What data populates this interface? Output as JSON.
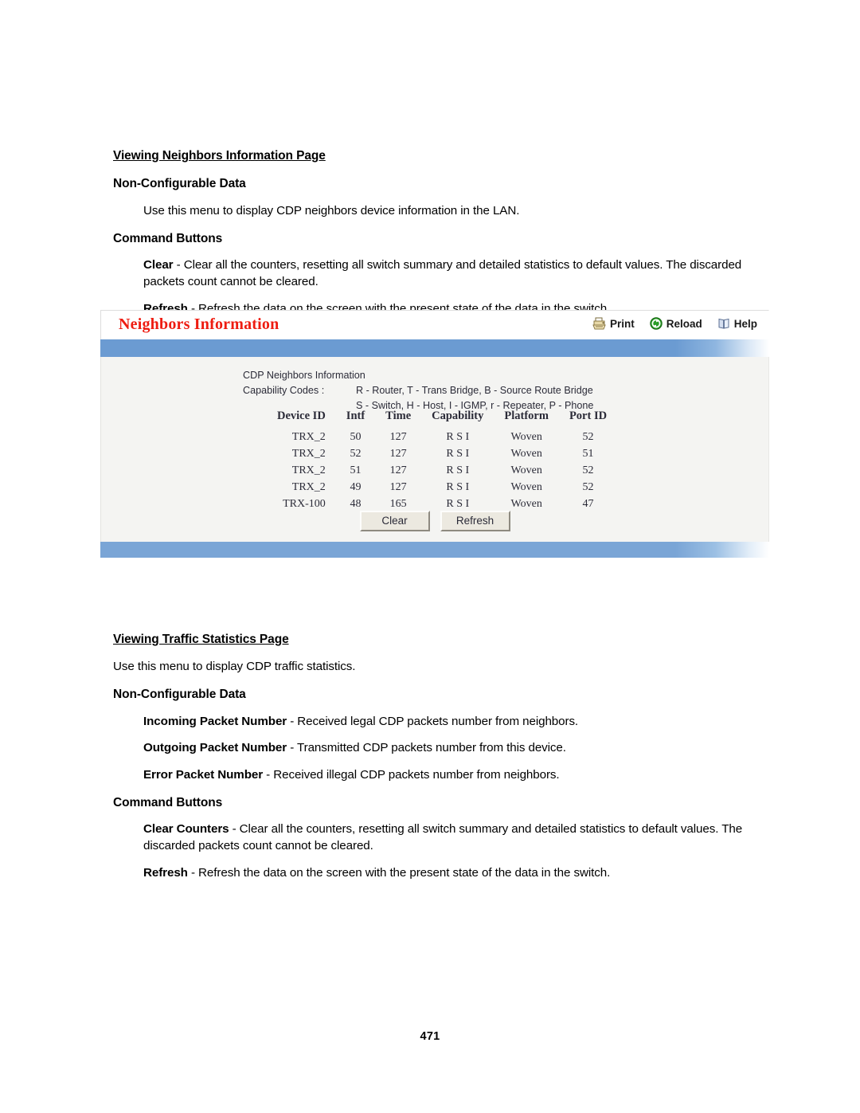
{
  "document": {
    "page_number": "471"
  },
  "section_one": {
    "heading": "Viewing Neighbors Information Page",
    "subheading_data": "Non-Configurable Data",
    "data_text": "Use this menu to display CDP neighbors device information in the LAN.",
    "subheading_buttons": "Command Buttons",
    "clear_label": "Clear",
    "clear_desc": " - Clear all the counters, resetting all switch summary and detailed statistics to default values. The discarded packets count cannot be cleared.",
    "refresh_label": "Refresh",
    "refresh_desc": " - Refresh the data on the screen with the present state of the data in the switch."
  },
  "screenshot": {
    "title": "Neighbors Information",
    "toolbar": [
      {
        "label": "Print",
        "icon": "printer-icon"
      },
      {
        "label": "Reload",
        "icon": "reload-icon"
      },
      {
        "label": "Help",
        "icon": "help-book-icon"
      }
    ],
    "info_title": "CDP Neighbors Information",
    "capability_label": "Capability Codes :",
    "capability_line1": "R - Router, T - Trans Bridge, B - Source Route Bridge",
    "capability_line2": "S - Switch, H - Host, I - IGMP, r - Repeater, P - Phone",
    "table": {
      "headers": [
        "Device ID",
        "Intf",
        "Time",
        "Capability",
        "Platform",
        "Port ID"
      ],
      "rows": [
        [
          "TRX_2",
          "50",
          "127",
          "R S I",
          "Woven",
          "52"
        ],
        [
          "TRX_2",
          "52",
          "127",
          "R S I",
          "Woven",
          "51"
        ],
        [
          "TRX_2",
          "51",
          "127",
          "R S I",
          "Woven",
          "52"
        ],
        [
          "TRX_2",
          "49",
          "127",
          "R S I",
          "Woven",
          "52"
        ],
        [
          "TRX-100",
          "48",
          "165",
          "R S I",
          "Woven",
          "47"
        ]
      ]
    },
    "buttons": [
      {
        "label": "Clear"
      },
      {
        "label": "Refresh"
      }
    ],
    "colors": {
      "title_red": "#ee1c11",
      "accent_blue": "#6b9bd2",
      "body_gray": "#f4f4f2"
    }
  },
  "section_two": {
    "heading": "Viewing Traffic Statistics Page",
    "intro_text": "Use this menu to display CDP traffic statistics.",
    "subheading_data": "Non-Configurable Data",
    "incoming_label": "Incoming Packet Number",
    "incoming_desc": " - Received legal CDP packets number from neighbors.",
    "outgoing_label": "Outgoing Packet Number",
    "outgoing_desc": " - Transmitted CDP packets number from this device.",
    "error_label": "Error Packet Number",
    "error_desc": " - Received illegal CDP packets number from neighbors.",
    "subheading_buttons": "Command Buttons",
    "clear_counters_label": "Clear Counters",
    "clear_counters_desc": " - Clear all the counters, resetting all switch summary and detailed statistics to default values. The discarded packets count cannot be cleared.",
    "refresh_label": "Refresh",
    "refresh_desc": " - Refresh the data on the screen with the present state of the data in the switch."
  }
}
